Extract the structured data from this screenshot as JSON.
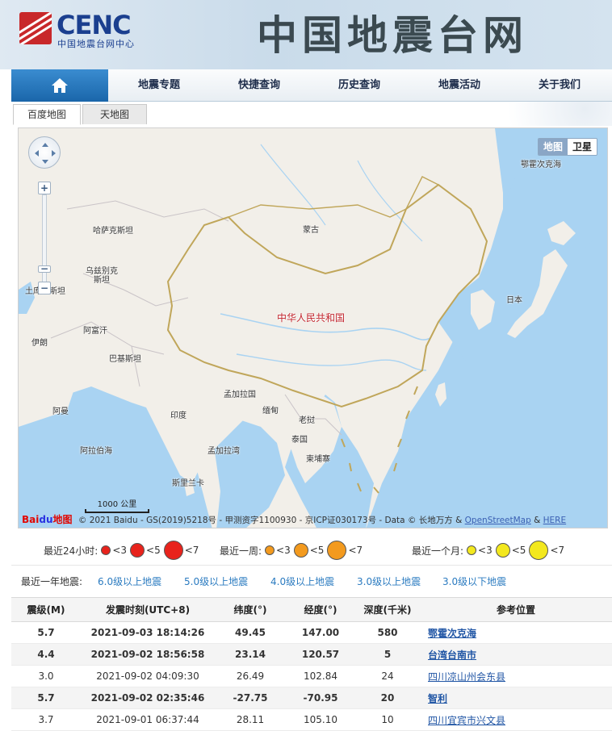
{
  "header": {
    "logo_text": "CENC",
    "logo_subtitle": "中国地震台网中心",
    "site_title": "中国地震台网"
  },
  "nav": {
    "home_icon": "home-icon",
    "items": [
      "地震专题",
      "快捷查询",
      "历史查询",
      "地震活动",
      "关于我们"
    ]
  },
  "map_tabs": [
    "百度地图",
    "天地图"
  ],
  "map": {
    "type_buttons": [
      "地图",
      "卫星"
    ],
    "labels": {
      "okhotsk": "鄂霍次克海",
      "kazakhstan": "哈萨克斯坦",
      "mongolia": "蒙古",
      "uzbekistan": "乌兹别克斯坦",
      "turkmenistan": "土库曼斯坦",
      "china": "中华人民共和国",
      "japan": "日本",
      "afghanistan": "阿富汗",
      "iran": "伊朗",
      "pakistan": "巴基斯坦",
      "bangladesh": "孟加拉国",
      "myanmar": "缅甸",
      "laos": "老挝",
      "thailand": "泰国",
      "cambodia": "柬埔寨",
      "oman": "阿曼",
      "india": "印度",
      "arabian_sea": "阿拉伯海",
      "bay_of_bengal": "孟加拉湾",
      "sri_lanka": "斯里兰卡"
    },
    "scale": "1000 公里",
    "baidu_logo": "Bai",
    "baidu_logo_mid": "du",
    "baidu_logo_end": "地图",
    "copyright_prefix": "© 2021 Baidu - GS(2019)5218号 - 甲测资字1100930 - 京ICP证030173号 - Data © 长地万方 &",
    "osm": "OpenStreetMap",
    "amp": "&",
    "here": "HERE"
  },
  "legend": {
    "day": {
      "label": "最近24小时:",
      "sizes": [
        "<3",
        "<5",
        "<7"
      ],
      "color": "#e8231c"
    },
    "week": {
      "label": "最近一周:",
      "sizes": [
        "<3",
        "<5",
        "<7"
      ],
      "color": "#f39a1e"
    },
    "month": {
      "label": "最近一个月:",
      "sizes": [
        "<3",
        "<5",
        "<7"
      ],
      "color": "#f3e81e"
    }
  },
  "filters": {
    "label": "最近一年地震:",
    "options": [
      "6.0级以上地震",
      "5.0级以上地震",
      "4.0级以上地震",
      "3.0级以上地震",
      "3.0级以下地震"
    ]
  },
  "table": {
    "headers": [
      "震级(M)",
      "发震时刻(UTC+8)",
      "纬度(°)",
      "经度(°)",
      "深度(千米)",
      "参考位置"
    ],
    "rows": [
      {
        "mag": "5.7",
        "time": "2021-09-03 18:14:26",
        "lat": "49.45",
        "lon": "147.00",
        "depth": "580",
        "place": "鄂霍次克海"
      },
      {
        "mag": "4.4",
        "time": "2021-09-02 18:56:58",
        "lat": "23.14",
        "lon": "120.57",
        "depth": "5",
        "place": "台湾台南市"
      },
      {
        "mag": "3.0",
        "time": "2021-09-02 04:09:30",
        "lat": "26.49",
        "lon": "102.84",
        "depth": "24",
        "place": "四川凉山州会东县"
      },
      {
        "mag": "5.7",
        "time": "2021-09-02 02:35:46",
        "lat": "-27.75",
        "lon": "-70.95",
        "depth": "20",
        "place": "智利"
      },
      {
        "mag": "3.7",
        "time": "2021-09-01 06:37:44",
        "lat": "28.11",
        "lon": "105.10",
        "depth": "10",
        "place": "四川宜宾市兴文县"
      }
    ]
  }
}
